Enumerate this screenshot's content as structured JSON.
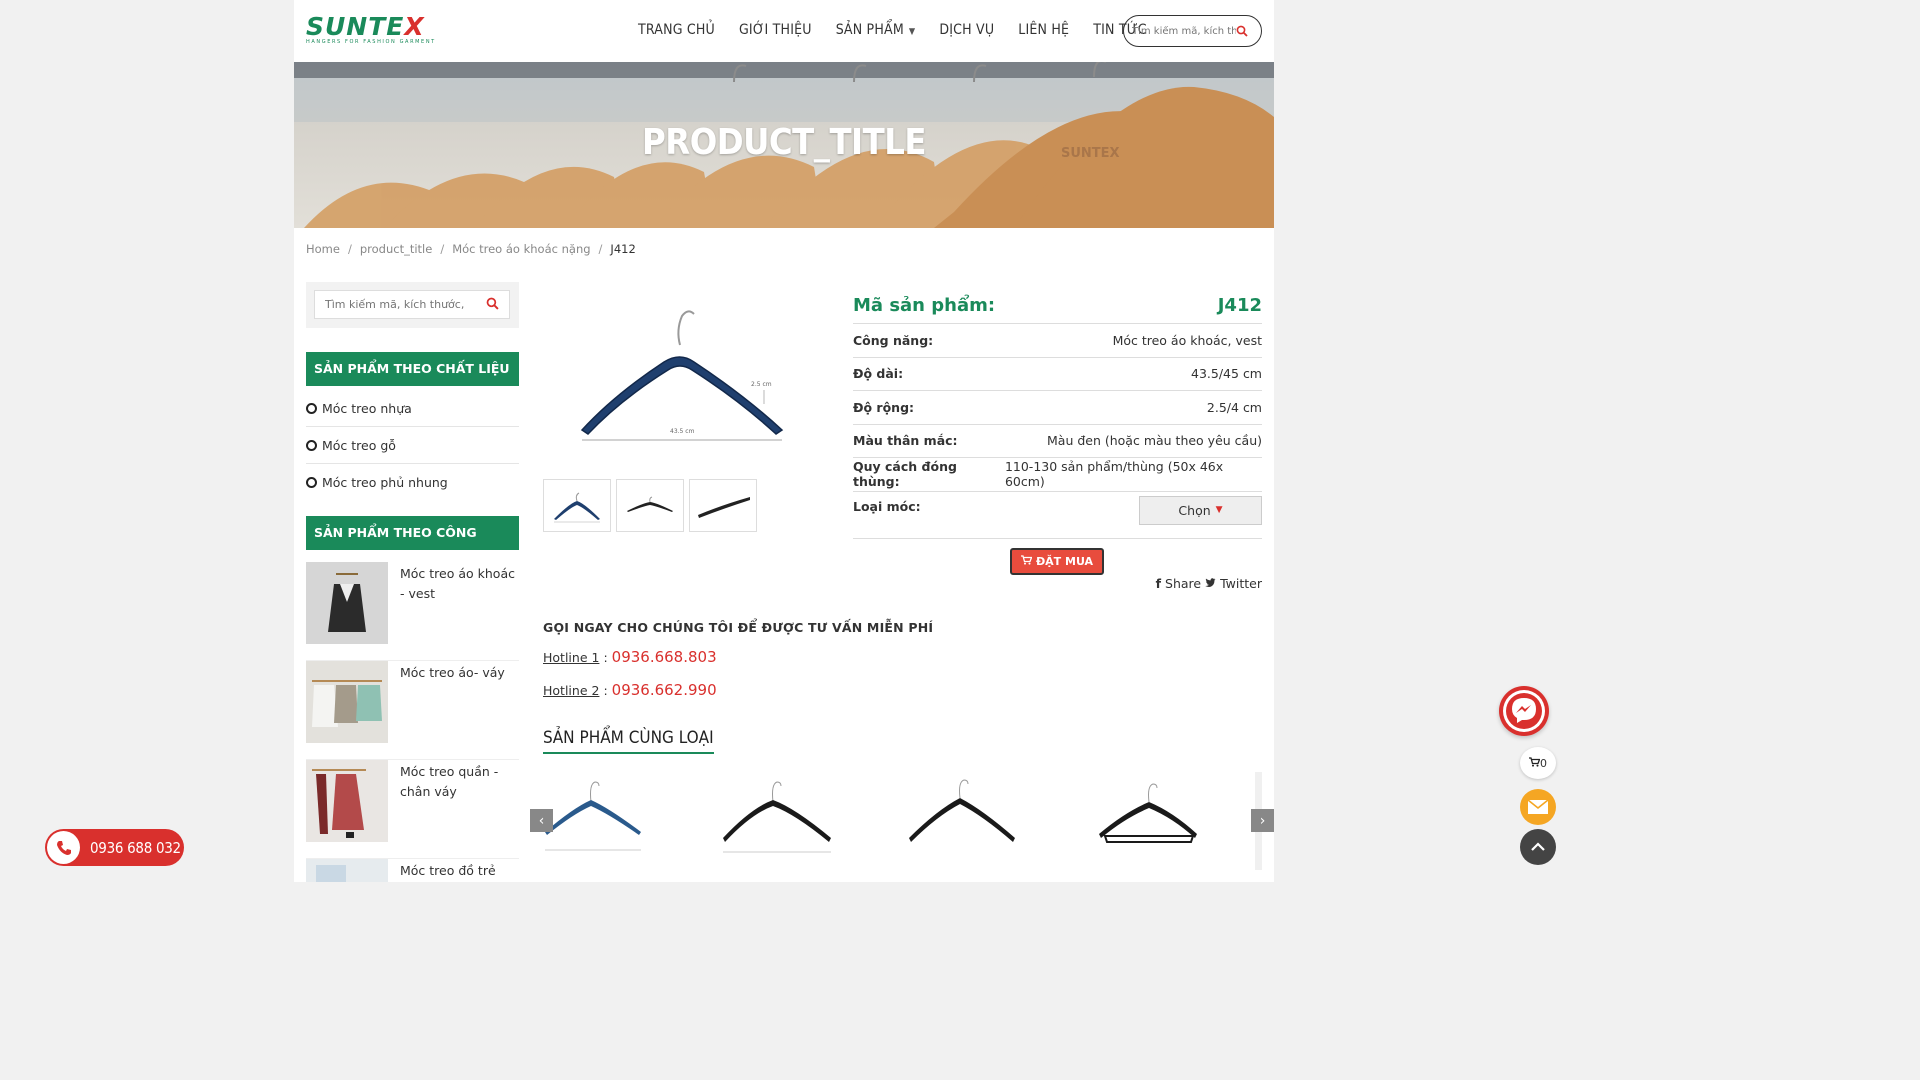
{
  "header": {
    "logo_text": "SUNTEX",
    "logo_tagline": "HANGERS FOR FASHION GARMENT",
    "nav": [
      "TRANG CHỦ",
      "GIỚI THIỆU",
      "SẢN PHẨM",
      "DỊCH VỤ",
      "LIÊN HỆ",
      "TIN TỨC"
    ],
    "search_placeholder": "Tìm kiếm mã, kích thước..."
  },
  "banner": {
    "title": "PRODUCT_TITLE",
    "watermark": "SUNTEX"
  },
  "breadcrumb": [
    "Home",
    "product_title",
    "Móc treo áo khoác nặng",
    "J412"
  ],
  "sidebar": {
    "search_placeholder": "Tìm kiếm mã, kích thước,",
    "material_heading": "SẢN PHẨM THEO CHẤT LIỆU",
    "materials": [
      "Móc treo nhựa",
      "Móc treo gỗ",
      "Móc treo phủ nhung"
    ],
    "function_heading": "SẢN PHẨM THEO CÔNG NĂNG",
    "functions": [
      "Móc treo áo khoác - vest",
      "Móc treo áo- váy",
      "Móc treo quần - chân váy",
      "Móc treo đồ trẻ"
    ]
  },
  "product": {
    "image_labels": {
      "width": "2.5 cm",
      "length": "43.5 cm"
    },
    "code_label": "Mã sản phẩm:",
    "code": "J412",
    "specs": [
      {
        "k": "Công năng:",
        "v": "Móc treo áo khoác, vest"
      },
      {
        "k": "Độ dài:",
        "v": "43.5/45 cm"
      },
      {
        "k": "Độ rộng:",
        "v": "2.5/4 cm"
      },
      {
        "k": "Màu thân mắc:",
        "v": "Màu đen (hoặc màu theo yêu cầu)"
      },
      {
        "k": "Quy cách đóng thùng:",
        "v": "110-130 sản phẩm/thùng (50x 46x 60cm)"
      }
    ],
    "hook_label": "Loại móc:",
    "hook_select": "Chọn",
    "buy_label": "ĐẶT MUA",
    "share_label": "Share",
    "twitter_label": "Twitter"
  },
  "contact": {
    "title": "GỌI NGAY CHO CHÚNG TÔI ĐỂ ĐƯỢC TƯ VẤN MIỄN PHÍ",
    "hotline1_label": "Hotline 1",
    "hotline1": "0936.668.803",
    "hotline2_label": "Hotline 2",
    "hotline2": "0936.662.990"
  },
  "related": {
    "title": "SẢN PHẨM CÙNG LOẠI",
    "item_colors": [
      "#2a5a8c",
      "#1a1a1a",
      "#1a1a1a",
      "#1a1a1a"
    ]
  },
  "floating": {
    "phone": "0936 688 032",
    "cart_count": "0"
  },
  "colors": {
    "brand_green": "#1a8a5a",
    "accent_red": "#d9302d"
  }
}
